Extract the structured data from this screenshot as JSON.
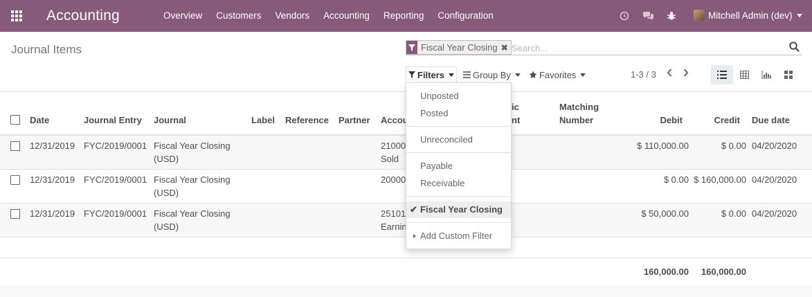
{
  "app": {
    "title": "Accounting",
    "menu": [
      "Overview",
      "Customers",
      "Vendors",
      "Accounting",
      "Reporting",
      "Configuration"
    ],
    "user_name": "Mitchell Admin (dev)",
    "brand_color": "#875a7b"
  },
  "control_panel": {
    "title": "Journal Items",
    "facet_label": "Fiscal Year Closing",
    "search_placeholder": "Search...",
    "filters_label": "Filters",
    "group_by_label": "Group By",
    "favorites_label": "Favorites",
    "pager": "1-3 / 3"
  },
  "filters_dropdown": {
    "items": [
      "Unposted",
      "Posted",
      "Unreconciled",
      "Payable",
      "Receivable",
      "Fiscal Year Closing",
      "Add Custom Filter"
    ],
    "selected": "Fiscal Year Closing"
  },
  "table": {
    "columns": {
      "date": "Date",
      "journal_entry": "Journal Entry",
      "journal": "Journal",
      "label": "Label",
      "reference": "Reference",
      "partner": "Partner",
      "account": "Accou",
      "analytic_1": "ic",
      "analytic_2": "nt",
      "matching_1": "Matching",
      "matching_2": "Number",
      "debit": "Debit",
      "credit": "Credit",
      "due_date": "Due date"
    },
    "rows": [
      {
        "date": "12/31/2019",
        "entry": "FYC/2019/0001",
        "journal_1": "Fiscal Year Closing",
        "journal_2": "(USD)",
        "account_1": "21000",
        "account_2": "Sold",
        "debit": "$ 110,000.00",
        "credit": "$ 0.00",
        "due": "04/20/2020"
      },
      {
        "date": "12/31/2019",
        "entry": "FYC/2019/0001",
        "journal_1": "Fiscal Year Closing",
        "journal_2": "(USD)",
        "account_1": "20000",
        "account_2": "",
        "debit": "$ 0.00",
        "credit": "$ 160,000.00",
        "due": "04/20/2020"
      },
      {
        "date": "12/31/2019",
        "entry": "FYC/2019/0001",
        "journal_1": "Fiscal Year Closing",
        "journal_2": "(USD)",
        "account_1": "25101",
        "account_2": "Earnin",
        "debit": "$ 50,000.00",
        "credit": "$ 0.00",
        "due": "04/20/2020"
      }
    ],
    "totals": {
      "debit": "160,000.00",
      "credit": "160,000.00"
    }
  }
}
